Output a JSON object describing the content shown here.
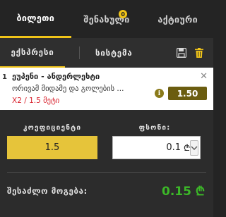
{
  "top_tabs": [
    {
      "label": "ბილეთი",
      "active": true
    },
    {
      "label": "შენახული",
      "count": "0"
    },
    {
      "label": "აქტიური"
    }
  ],
  "sub_tabs": {
    "express": "ექსპრესი",
    "system": "სისტემა"
  },
  "icons": {
    "save": "save-icon",
    "trash": "trash-icon",
    "close": "close-icon",
    "info": "info-icon",
    "dropdown": "chevron-down-icon"
  },
  "bet": {
    "index": "1",
    "title": "ეუპენი - ანდერლეხტი",
    "market": "ორივამ მიდამე და გოლების ...",
    "pick": "X2 / 1.5 მეტი",
    "odds": "1.50",
    "info_glyph": "i"
  },
  "stake_panel": {
    "coef_label": "კოეფიციენტი",
    "coef_value": "1.5",
    "stake_label": "ფსონი:",
    "stake_value": "0.1",
    "currency": "₾",
    "winnings_label": "შესაძლო მოგება:",
    "winnings_value": "0.15 ₾"
  },
  "colors": {
    "accent": "#f0c419",
    "win": "#3cb828",
    "pick": "#d9232e",
    "odds_badge": "#6b5d10"
  }
}
